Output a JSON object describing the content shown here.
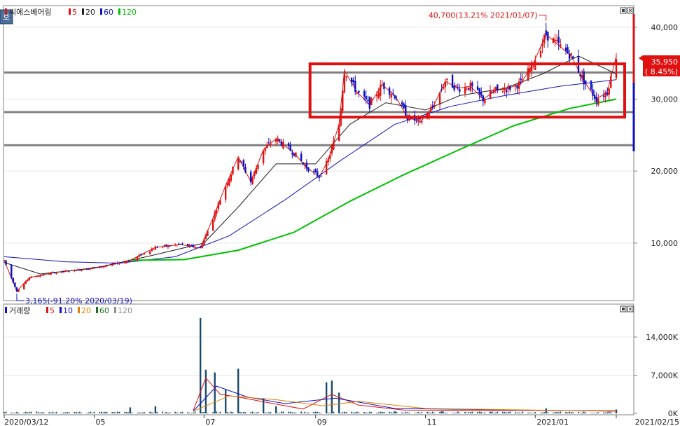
{
  "ui": {
    "corner_button": "호",
    "stock_name": "씨에스베어링",
    "price_legend": [
      {
        "label": "5",
        "color": "#e01010"
      },
      {
        "label": "20",
        "color": "#202020"
      },
      {
        "label": "60",
        "color": "#1010c0"
      },
      {
        "label": "120",
        "color": "#00c000"
      }
    ],
    "volume_title": "거래량",
    "volume_legend": [
      {
        "label": "5",
        "color": "#e01010"
      },
      {
        "label": "10",
        "color": "#1010c0"
      },
      {
        "label": "20",
        "color": "#e08000"
      },
      {
        "label": "60",
        "color": "#207020"
      },
      {
        "label": "120",
        "color": "#909090"
      }
    ],
    "high_annotation": "40,700(13.21% 2021/01/07)",
    "low_annotation": "3,165(-91.20% 2020/03/19)",
    "current_price": "35,950",
    "current_change": "( 8.45%)",
    "colors": {
      "up": "#e01010",
      "down": "#1010c0",
      "volume": "#1a4a6a",
      "box": "#e01010",
      "hline": "#808080",
      "axis_bg": "#ffffff"
    }
  },
  "chart_data": [
    {
      "type": "candlestick",
      "title": "씨에스베어링",
      "y_tick_labels": [
        "40,000",
        "30,000",
        "20,000",
        "10,000"
      ],
      "y_ticks": [
        40000,
        30000,
        20000,
        10000
      ],
      "ylim": [
        2000,
        43000
      ],
      "x_tick_labels": [
        "2020/03/12",
        "05",
        "07",
        "09",
        "11",
        "2021/01",
        "2021/02/15"
      ],
      "x_tick_dates": [
        "2020-03-12",
        "2020-05-01",
        "2020-07-01",
        "2020-09-01",
        "2020-11-01",
        "2021-01-01",
        "2021-02-15"
      ],
      "x_range": [
        "2020-03-12",
        "2021-02-15"
      ],
      "close_series": [
        [
          "2020-03-12",
          7600
        ],
        [
          "2020-03-19",
          3300
        ],
        [
          "2020-03-26",
          5200
        ],
        [
          "2020-04-09",
          5900
        ],
        [
          "2020-04-23",
          6300
        ],
        [
          "2020-05-07",
          6800
        ],
        [
          "2020-05-21",
          7600
        ],
        [
          "2020-06-04",
          9400
        ],
        [
          "2020-06-18",
          9800
        ],
        [
          "2020-06-29",
          9300
        ],
        [
          "2020-07-06",
          13500
        ],
        [
          "2020-07-13",
          18000
        ],
        [
          "2020-07-20",
          22000
        ],
        [
          "2020-07-27",
          18500
        ],
        [
          "2020-08-03",
          23000
        ],
        [
          "2020-08-10",
          24500
        ],
        [
          "2020-08-20",
          22500
        ],
        [
          "2020-08-27",
          20500
        ],
        [
          "2020-09-03",
          19200
        ],
        [
          "2020-09-08",
          21500
        ],
        [
          "2020-09-14",
          26500
        ],
        [
          "2020-09-17",
          34000
        ],
        [
          "2020-09-24",
          31000
        ],
        [
          "2020-10-01",
          29200
        ],
        [
          "2020-10-08",
          32000
        ],
        [
          "2020-10-15",
          30500
        ],
        [
          "2020-10-22",
          27500
        ],
        [
          "2020-10-29",
          26800
        ],
        [
          "2020-11-05",
          28800
        ],
        [
          "2020-11-12",
          32500
        ],
        [
          "2020-11-19",
          31500
        ],
        [
          "2020-11-26",
          31800
        ],
        [
          "2020-12-03",
          30000
        ],
        [
          "2020-12-10",
          31200
        ],
        [
          "2020-12-17",
          31500
        ],
        [
          "2020-12-24",
          32200
        ],
        [
          "2020-12-31",
          35000
        ],
        [
          "2021-01-07",
          39000
        ],
        [
          "2021-01-14",
          37500
        ],
        [
          "2021-01-21",
          36000
        ],
        [
          "2021-01-28",
          32500
        ],
        [
          "2021-02-04",
          30000
        ],
        [
          "2021-02-10",
          31000
        ],
        [
          "2021-02-15",
          35950
        ]
      ],
      "moving_averages": {
        "ma20": [
          [
            "2020-03-12",
            7300
          ],
          [
            "2020-04-01",
            5700
          ],
          [
            "2020-05-01",
            6500
          ],
          [
            "2020-06-01",
            8200
          ],
          [
            "2020-07-01",
            10000
          ],
          [
            "2020-07-20",
            15000
          ],
          [
            "2020-08-10",
            21000
          ],
          [
            "2020-09-01",
            21000
          ],
          [
            "2020-09-20",
            26500
          ],
          [
            "2020-10-10",
            29500
          ],
          [
            "2020-11-01",
            28500
          ],
          [
            "2020-11-20",
            30500
          ],
          [
            "2020-12-15",
            31500
          ],
          [
            "2021-01-05",
            33500
          ],
          [
            "2021-01-25",
            36000
          ],
          [
            "2021-02-15",
            33500
          ]
        ],
        "ma60": [
          [
            "2020-03-12",
            8100
          ],
          [
            "2020-04-15",
            7400
          ],
          [
            "2020-05-15",
            7200
          ],
          [
            "2020-06-15",
            8100
          ],
          [
            "2020-07-15",
            11000
          ],
          [
            "2020-08-15",
            16000
          ],
          [
            "2020-09-15",
            21500
          ],
          [
            "2020-10-15",
            26500
          ],
          [
            "2020-11-15",
            29000
          ],
          [
            "2020-12-15",
            30500
          ],
          [
            "2021-01-15",
            31800
          ],
          [
            "2021-02-15",
            32700
          ]
        ],
        "ma120": [
          [
            "2020-05-20",
            7600
          ],
          [
            "2020-06-20",
            7700
          ],
          [
            "2020-07-20",
            9000
          ],
          [
            "2020-08-20",
            11500
          ],
          [
            "2020-09-20",
            15800
          ],
          [
            "2020-10-20",
            19500
          ],
          [
            "2020-11-20",
            23000
          ],
          [
            "2020-12-20",
            26300
          ],
          [
            "2021-01-20",
            28700
          ],
          [
            "2021-02-15",
            30000
          ]
        ]
      },
      "horizontal_lines": [
        33700,
        28200,
        23600
      ],
      "highlight_box": {
        "from": "2020-09-01",
        "to": "2021-02-15",
        "top": 34900,
        "bottom": 27500
      },
      "annotations": [
        {
          "text": "40,700(13.21% 2021/01/07)",
          "date": "2021-01-07",
          "value": 40700
        },
        {
          "text": "3,165(-91.20% 2020/03/19)",
          "date": "2020-03-19",
          "value": 3165
        }
      ]
    },
    {
      "type": "bar",
      "title": "거래량",
      "y_tick_labels": [
        "14,000K",
        "7,000K",
        "0K"
      ],
      "y_ticks": [
        14000,
        7000,
        0
      ],
      "ylim": [
        0,
        18500
      ],
      "units": "K",
      "values": [
        [
          "2020-05-21",
          1100
        ],
        [
          "2020-06-04",
          1300
        ],
        [
          "2020-06-29",
          17500
        ],
        [
          "2020-07-02",
          8000
        ],
        [
          "2020-07-07",
          7500
        ],
        [
          "2020-07-13",
          4400
        ],
        [
          "2020-07-20",
          8200
        ],
        [
          "2020-08-03",
          2800
        ],
        [
          "2020-08-10",
          1300
        ],
        [
          "2020-09-07",
          5700
        ],
        [
          "2020-09-10",
          6000
        ],
        [
          "2020-09-14",
          3800
        ],
        [
          "2020-10-15",
          400
        ],
        [
          "2020-11-10",
          400
        ],
        [
          "2020-12-07",
          300
        ],
        [
          "2021-01-07",
          900
        ],
        [
          "2021-02-15",
          700
        ]
      ],
      "moving_averages": {
        "ma5": [
          [
            "2020-06-25",
            500
          ],
          [
            "2020-07-02",
            6500
          ],
          [
            "2020-07-10",
            3500
          ],
          [
            "2020-07-20",
            3000
          ],
          [
            "2020-08-05",
            2000
          ],
          [
            "2020-08-25",
            800
          ],
          [
            "2020-09-10",
            3500
          ],
          [
            "2020-09-25",
            1500
          ],
          [
            "2020-10-20",
            600
          ],
          [
            "2021-02-15",
            500
          ]
        ],
        "ma10": [
          [
            "2020-06-25",
            400
          ],
          [
            "2020-07-08",
            5000
          ],
          [
            "2020-07-25",
            3000
          ],
          [
            "2020-08-15",
            1800
          ],
          [
            "2020-09-12",
            2800
          ],
          [
            "2020-10-15",
            900
          ],
          [
            "2021-02-15",
            400
          ]
        ],
        "ma20": [
          [
            "2020-06-25",
            400
          ],
          [
            "2020-07-15",
            3200
          ],
          [
            "2020-08-10",
            2500
          ],
          [
            "2020-09-05",
            1400
          ],
          [
            "2020-09-25",
            2200
          ],
          [
            "2020-11-01",
            900
          ],
          [
            "2021-02-15",
            400
          ]
        ]
      }
    }
  ]
}
